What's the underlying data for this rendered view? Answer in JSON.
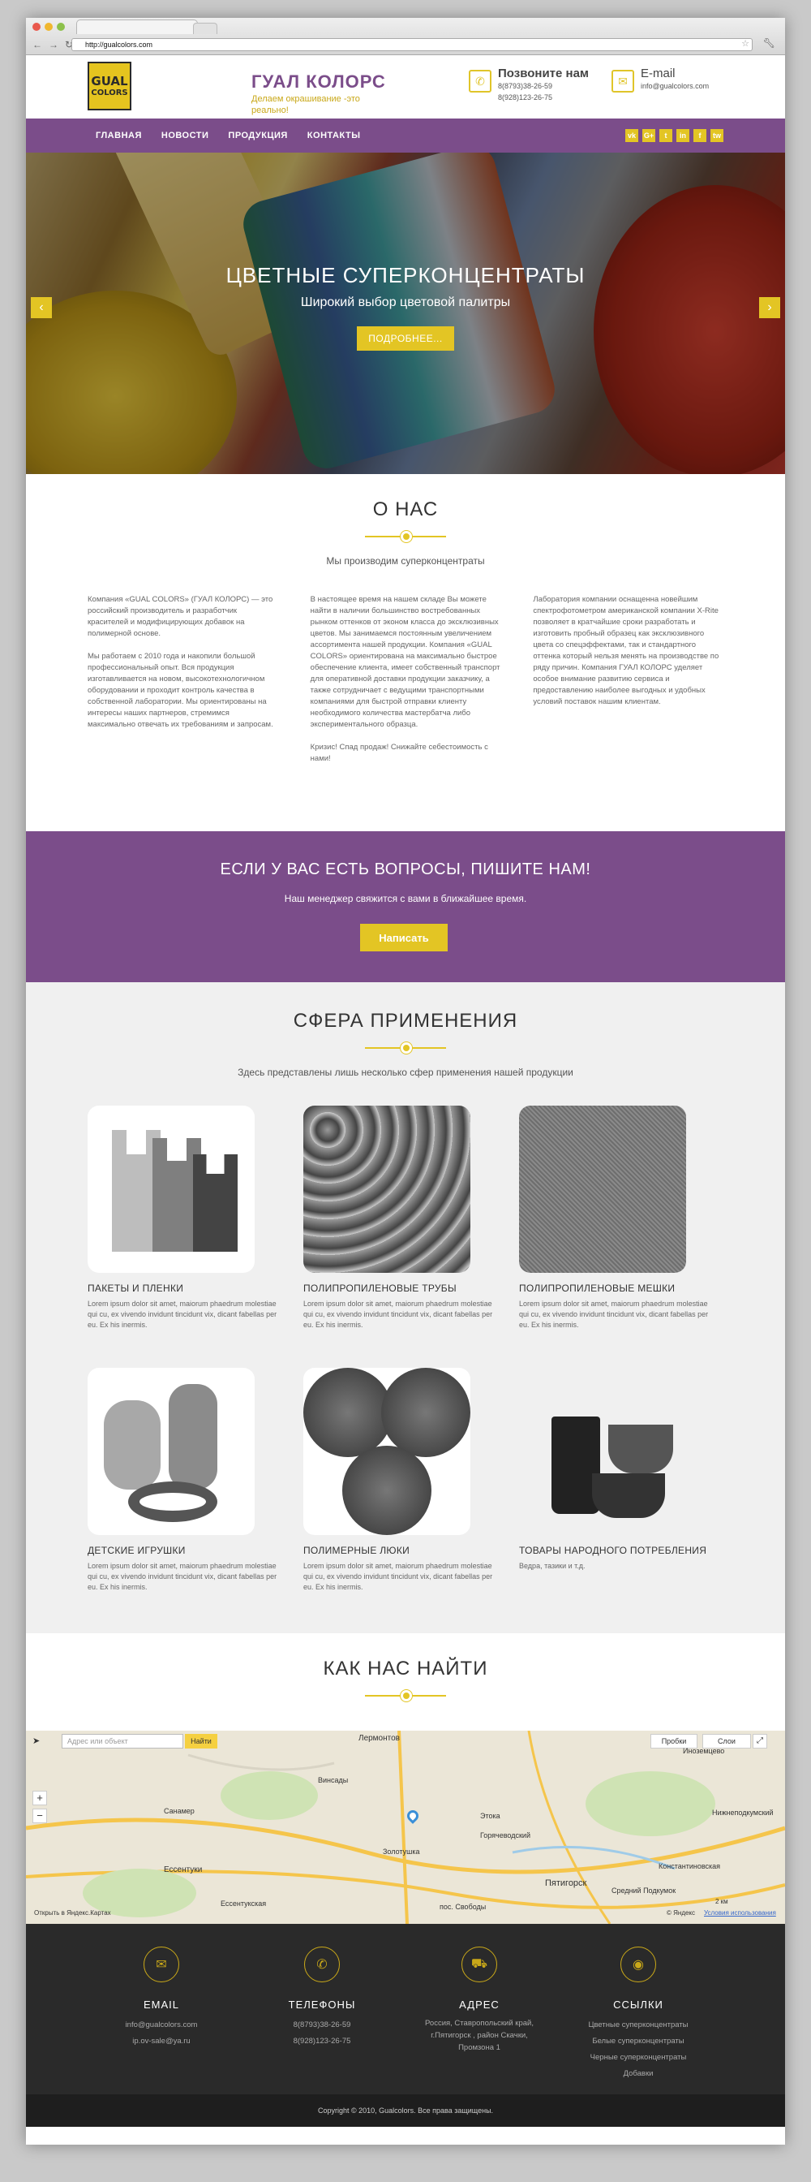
{
  "browser": {
    "url": "http://gualcolors.com",
    "dot_colors": [
      "#e9584c",
      "#f0b72f",
      "#8dc14b"
    ]
  },
  "header": {
    "logo_line1": "GUAL",
    "logo_line2": "COLORS",
    "brand_name": "ГУАЛ КОЛОРС",
    "tagline": "Делаем окрашивание -это реально!",
    "phone_title": "Позвоните нам",
    "phone1": "8(8793)38-26-59",
    "phone2": "8(928)123-26-75",
    "email_title": "E-mail",
    "email": "info@gualcolors.com"
  },
  "nav": {
    "items": [
      "ГЛАВНАЯ",
      "НОВОСТИ",
      "ПРОДУКЦИЯ",
      "КОНТАКТЫ"
    ],
    "social": [
      "vk",
      "G+",
      "t",
      "in",
      "f",
      "tw"
    ]
  },
  "hero": {
    "title": "ЦВЕТНЫЕ СУПЕРКОНЦЕНТРАТЫ",
    "subtitle": "Широкий выбор цветовой палитры",
    "button": "ПОДРОБНЕЕ...",
    "prev": "‹",
    "next": "›"
  },
  "about": {
    "title": "О НАС",
    "subtitle": "Мы производим суперконцентраты",
    "col1": "Компания «GUAL COLORS» (ГУАЛ КОЛОРС) — это российский производитель и разработчик красителей и модифицирующих добавок на полимерной основе.\n\nМы работаем с 2010 года и накопили большой профессиональный опыт. Вся продукция изготавливается на новом, высокотехнологичном оборудовании и проходит контроль качества в собственной лаборатории. Мы ориентированы на интересы наших партнеров, стремимся максимально отвечать их требованиям и запросам.",
    "col2": "В настоящее время на нашем складе Вы можете найти в наличии большинство востребованных рынком оттенков от эконом класса до эксклюзивных цветов. Мы занимаемся постоянным увеличением ассортимента нашей продукции. Компания «GUAL COLORS» ориентирована на максимально быстрое обеспечение клиента, имеет собственный транспорт для оперативной доставки продукции заказчику, а также сотрудничает с ведущими транспортными компаниями для быстрой отправки клиенту необходимого количества мастербатча либо экспериментального образца.\n\nКризис! Спад продаж! Снижайте себестоимость с нами!",
    "col3": "Лаборатория компании оснащенна новейшим спектрофотометром американской компании X-Rite позволяет в кратчайшие сроки разработать и изготовить пробный образец как эксклюзивного цвета со спецэффектами, так и стандартного оттенка который нельзя менять на производстве по ряду причин. Компания ГУАЛ КОЛОРС уделяет особое внимание развитию сервиса и предоставлению наиболее выгодных и удобных условий поставок нашим клиентам."
  },
  "cta": {
    "title": "ЕСЛИ У ВАС ЕСТЬ ВОПРОСЫ, ПИШИТЕ НАМ!",
    "subtitle": "Наш менеджер свяжится с вами в ближайшее время.",
    "button": "Написать"
  },
  "applications": {
    "title": "СФЕРА ПРИМЕНЕНИЯ",
    "subtitle": "Здесь представлены лишь несколько сфер применения нашей продукции",
    "items": [
      {
        "title": "ПАКЕТЫ И ПЛЕНКИ",
        "desc": "Lorem ipsum dolor sit amet, maiorum phaedrum molestiae qui cu, ex vivendo invidunt tincidunt vix, dicant fabellas per eu. Ex his inermis."
      },
      {
        "title": "ПОЛИПРОПИЛЕНОВЫЕ ТРУБЫ",
        "desc": "Lorem ipsum dolor sit amet, maiorum phaedrum molestiae qui cu, ex vivendo invidunt tincidunt vix, dicant fabellas per eu. Ex his inermis."
      },
      {
        "title": "ПОЛИПРОПИЛЕНОВЫЕ МЕШКИ",
        "desc": "Lorem ipsum dolor sit amet, maiorum phaedrum molestiae qui cu, ex vivendo invidunt tincidunt vix, dicant fabellas per eu. Ex his inermis."
      },
      {
        "title": "ДЕТСКИЕ ИГРУШКИ",
        "desc": "Lorem ipsum dolor sit amet, maiorum phaedrum molestiae qui cu, ex vivendo invidunt tincidunt vix, dicant fabellas per eu. Ex his inermis."
      },
      {
        "title": "ПОЛИМЕРНЫЕ ЛЮКИ",
        "desc": "Lorem ipsum dolor sit amet, maiorum phaedrum molestiae qui cu, ex vivendo invidunt tincidunt vix, dicant fabellas per eu. Ex his inermis."
      },
      {
        "title": "ТОВАРЫ НАРОДНОГО ПОТРЕБЛЕНИЯ",
        "desc": "Ведра, тазики и т.д."
      }
    ]
  },
  "find": {
    "title": "КАК НАС НАЙТИ"
  },
  "map": {
    "search_placeholder": "Адрес или объект",
    "search_button": "Найти",
    "traffic": "Пробки",
    "layers": "Слои",
    "open_link": "Открыть в Яндекс.Картах",
    "yandex": "© Яндекс",
    "terms": "Условия использования",
    "scale": "2 км",
    "places": [
      "Лермонтов",
      "Иноземцево",
      "Винсады",
      "Санамер",
      "Ессентуки",
      "Золотушка",
      "Пятигорск",
      "Константиновская",
      "Средний Подкумок",
      "Ессентукская",
      "Нижнеподкумский",
      "Горячеводский",
      "пос. Свободы",
      "Этока"
    ]
  },
  "footer": {
    "cols": [
      {
        "icon": "✉",
        "title": "EMAIL",
        "lines": [
          "info@gualcolors.com",
          "ip.ov-sale@ya.ru"
        ]
      },
      {
        "icon": "✆",
        "title": "ТЕЛЕФОНЫ",
        "lines": [
          "8(8793)38-26-59",
          "8(928)123-26-75"
        ]
      },
      {
        "icon": "⛟",
        "title": "АДРЕС",
        "lines": [
          "Россия, Ставропольский край,",
          "г.Пятигорск , район Скачки,",
          "Промзона 1"
        ]
      },
      {
        "icon": "◉",
        "title": "ССЫЛКИ",
        "lines": [
          "Цветные суперконцентраты",
          "Белые суперконцентраты",
          "Черные суперконцентраты",
          "Добавки"
        ]
      }
    ],
    "copyright": "Copyright © 2010, Gualcolors. Все права защищены."
  },
  "colors": {
    "purple": "#7b4d8a",
    "yellow": "#e3c524"
  }
}
